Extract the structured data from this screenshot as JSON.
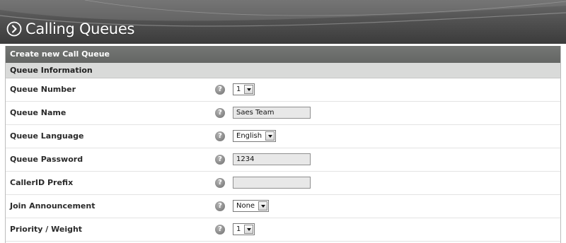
{
  "header": {
    "title": "Calling Queues",
    "icon": "circle-arrow-right-icon"
  },
  "panel": {
    "title": "Create new Call Queue",
    "section_title": "Queue Information",
    "help_icon_glyph": "?"
  },
  "fields": {
    "queue_number": {
      "label": "Queue Number",
      "type": "select",
      "value": "1"
    },
    "queue_name": {
      "label": "Queue Name",
      "type": "text",
      "value": "Saes Team"
    },
    "queue_language": {
      "label": "Queue Language",
      "type": "select",
      "value": "English"
    },
    "queue_password": {
      "label": "Queue Password",
      "type": "text",
      "value": "1234"
    },
    "callerid_prefix": {
      "label": "CallerID Prefix",
      "type": "text",
      "value": ""
    },
    "join_announcement": {
      "label": "Join Announcement",
      "type": "select",
      "value": "None"
    },
    "priority_weight": {
      "label": "Priority / Weight",
      "type": "select",
      "value": "1"
    }
  },
  "colors": {
    "header_bg": "#525252",
    "panel_title_bg": "#6e706e",
    "section_bg": "#d9dad9",
    "input_bg": "#e8e8e8"
  }
}
